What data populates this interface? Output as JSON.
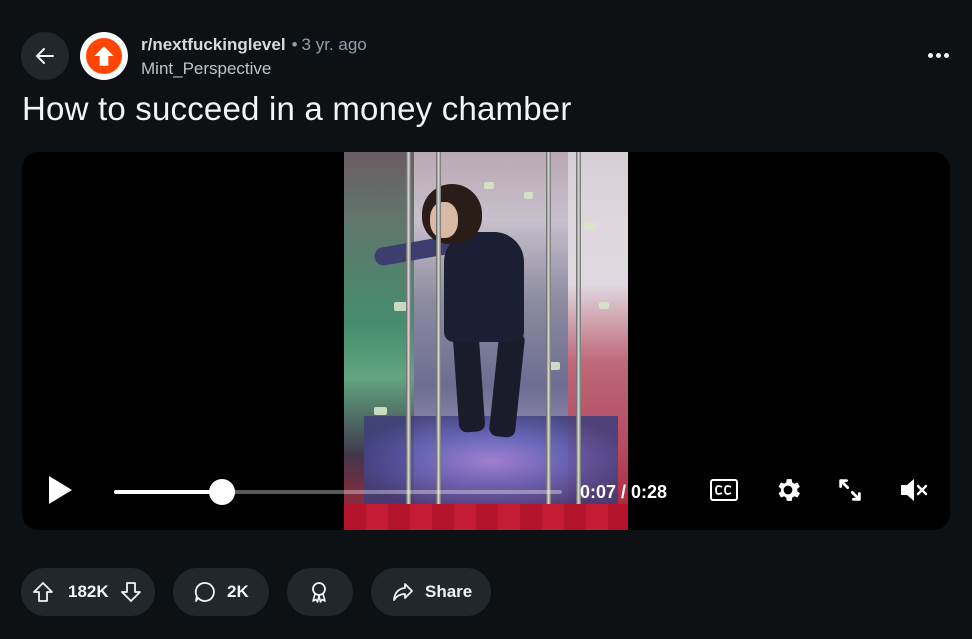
{
  "post": {
    "subreddit": "r/nextfuckinglevel",
    "separator": "•",
    "age": "3 yr. ago",
    "author": "Mint_Perspective",
    "title": "How to succeed in a money chamber"
  },
  "video": {
    "current_time": "0:07",
    "duration": "0:28",
    "time_display": "0:07 / 0:28",
    "progress_fraction": 0.24,
    "muted": true
  },
  "actions": {
    "score": "182K",
    "comments": "2K",
    "share_label": "Share"
  },
  "colors": {
    "background": "#0e1113",
    "pill": "#21272a",
    "subreddit_avatar": "#ff4500",
    "muted_text": "#8ba2ad"
  },
  "icons": {
    "back": "arrow-left-icon",
    "subreddit": "upvote-arrow-logo",
    "more": "ellipsis-icon",
    "play": "play-icon",
    "captions": "cc-icon",
    "settings": "gear-icon",
    "fullscreen": "expand-icon",
    "volume": "muted-speaker-icon",
    "upvote": "upvote-icon",
    "downvote": "downvote-icon",
    "comment": "comment-icon",
    "award": "award-icon",
    "share": "share-icon"
  }
}
